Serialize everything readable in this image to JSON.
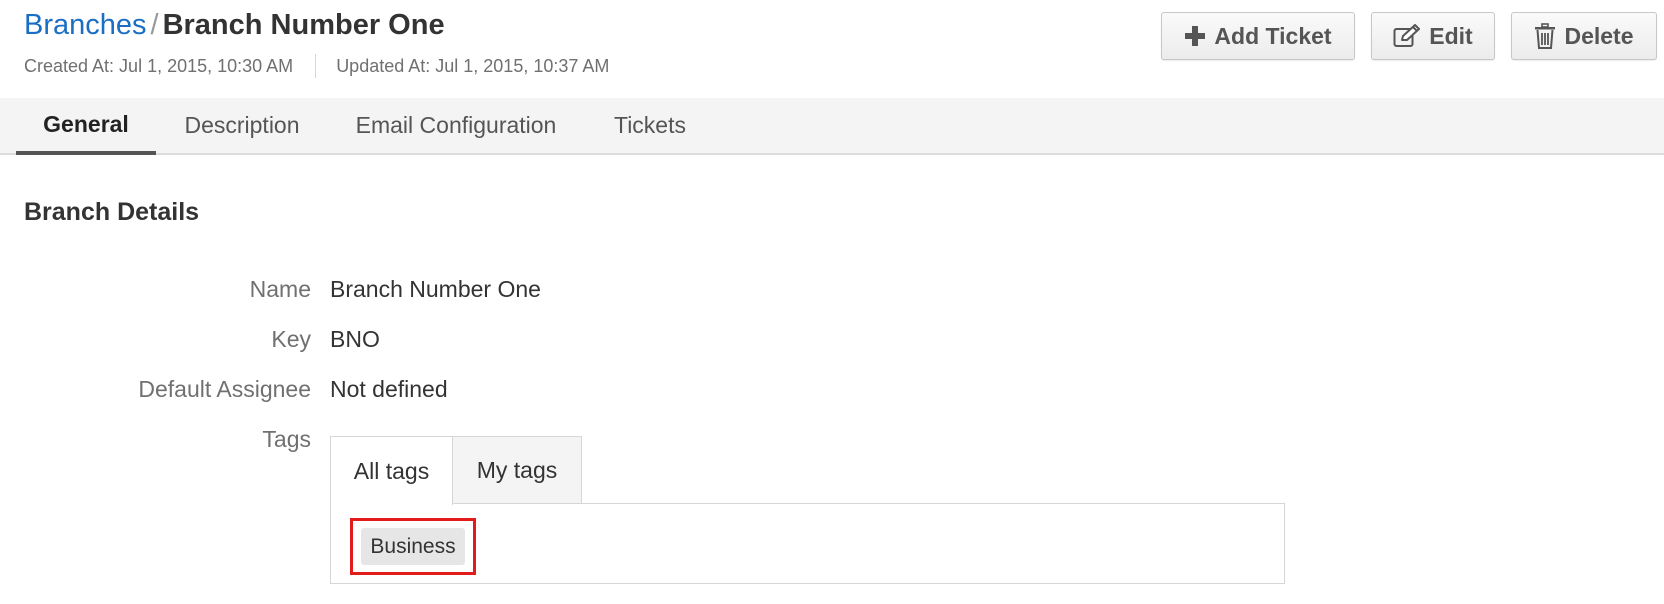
{
  "breadcrumb": {
    "parent": "Branches",
    "separator": "/",
    "current": "Branch Number One"
  },
  "meta": {
    "created": "Created At: Jul 1, 2015, 10:30 AM",
    "updated": "Updated At: Jul 1, 2015, 10:37 AM"
  },
  "toolbar": {
    "add_ticket": "Add Ticket",
    "edit": "Edit",
    "delete": "Delete"
  },
  "tabs": [
    {
      "label": "General",
      "active": true
    },
    {
      "label": "Description",
      "active": false
    },
    {
      "label": "Email Configuration",
      "active": false
    },
    {
      "label": "Tickets",
      "active": false
    }
  ],
  "section": {
    "title": "Branch Details"
  },
  "fields": {
    "name": {
      "label": "Name",
      "value": "Branch Number One"
    },
    "key": {
      "label": "Key",
      "value": "BNO"
    },
    "default_assignee": {
      "label": "Default Assignee",
      "value": "Not defined"
    },
    "tags": {
      "label": "Tags"
    }
  },
  "tags_widget": {
    "tabs": [
      {
        "label": "All tags",
        "active": true
      },
      {
        "label": "My tags",
        "active": false
      }
    ],
    "items": [
      "Business"
    ]
  },
  "colors": {
    "link": "#1a6fc4",
    "highlight": "#e31b1b",
    "tabbar_bg": "#f4f4f4"
  },
  "icons": {
    "add_ticket": "plus-icon",
    "edit": "edit-icon",
    "delete": "trash-icon"
  }
}
